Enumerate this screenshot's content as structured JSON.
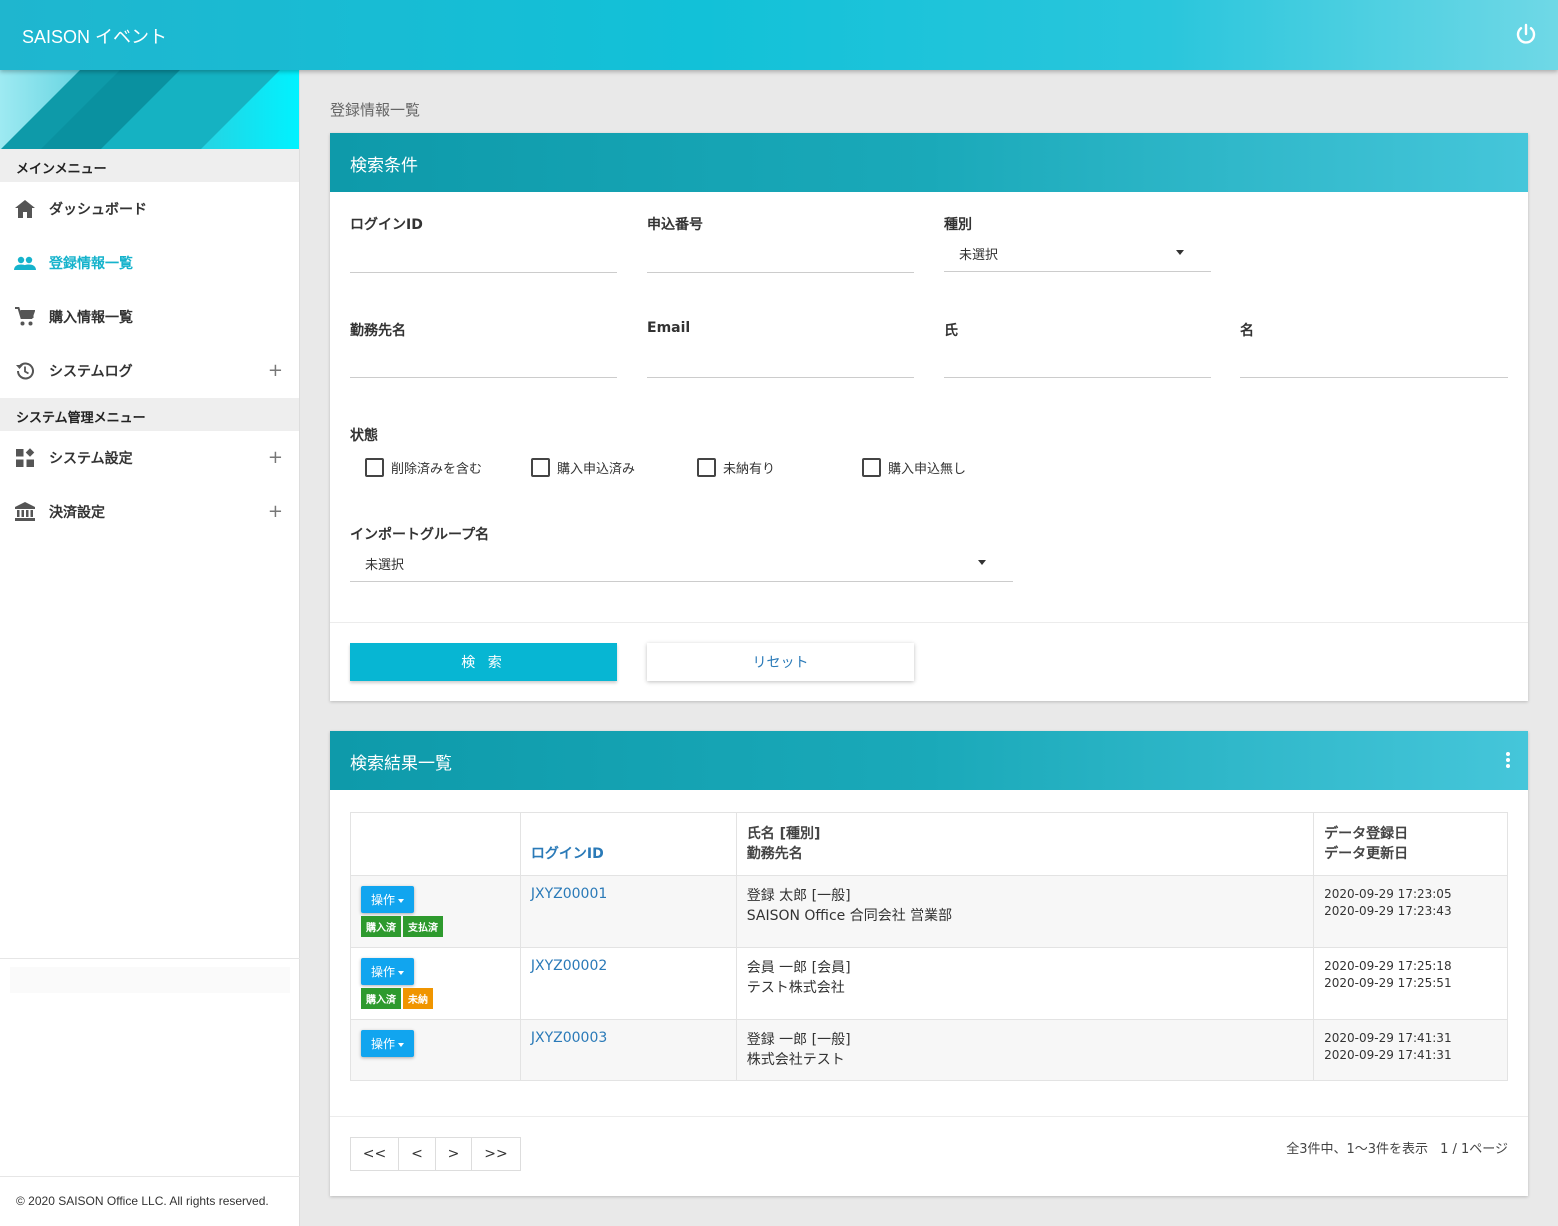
{
  "app": {
    "title": "SAISON イベント"
  },
  "sidebar": {
    "sections": [
      {
        "title": "メインメニュー"
      },
      {
        "title": "システム管理メニュー"
      }
    ],
    "items": [
      {
        "label": "ダッシュボード",
        "icon": "home-icon"
      },
      {
        "label": "登録情報一覧",
        "icon": "people-icon",
        "active": true
      },
      {
        "label": "購入情報一覧",
        "icon": "cart-icon"
      },
      {
        "label": "システムログ",
        "icon": "history-icon",
        "expandable": "+"
      },
      {
        "label": "システム設定",
        "icon": "widgets-icon",
        "expandable": "+"
      },
      {
        "label": "決済設定",
        "icon": "bank-icon",
        "expandable": "+"
      }
    ],
    "copyright": "© 2020 SAISON Office LLC. All rights reserved."
  },
  "page": {
    "title": "登録情報一覧"
  },
  "search": {
    "title": "検索条件",
    "fields": {
      "login_id": "ログインID",
      "application_no": "申込番号",
      "type": "種別",
      "type_value": "未選択",
      "company": "勤務先名",
      "email": "Email",
      "last_name": "氏",
      "first_name": "名",
      "status": "状態",
      "import_group": "インポートグループ名",
      "import_group_value": "未選択"
    },
    "checkboxes": [
      "削除済みを含む",
      "購入申込済み",
      "未納有り",
      "購入申込無し"
    ],
    "search_button": "検 索",
    "reset_button": "リセット"
  },
  "results": {
    "title": "検索結果一覧",
    "headers": {
      "login_id": "ログインID",
      "name_line1": "氏名 [種別]",
      "name_line2": "勤務先名",
      "date_line1": "データ登録日",
      "date_line2": "データ更新日"
    },
    "op_label": "操作",
    "rows": [
      {
        "login_id": "JXYZ00001",
        "name": "登録 太郎 [一般]",
        "company": "SAISON Office 合同会社 営業部",
        "created": "2020-09-29 17:23:05",
        "updated": "2020-09-29 17:23:43",
        "badge1": "購入済",
        "badge2": "支払済"
      },
      {
        "login_id": "JXYZ00002",
        "name": "会員 一郎 [会員]",
        "company": "テスト株式会社",
        "created": "2020-09-29 17:25:18",
        "updated": "2020-09-29 17:25:51",
        "badge1": "購入済",
        "badge2": "未納"
      },
      {
        "login_id": "JXYZ00003",
        "name": "登録 一郎 [一般]",
        "company": "株式会社テスト",
        "created": "2020-09-29 17:41:31",
        "updated": "2020-09-29 17:41:31"
      }
    ],
    "pager": {
      "first": "<<",
      "prev": "<",
      "next": ">",
      "last": ">>"
    },
    "summary": "全3件中、1〜3件を表示",
    "page_info": "1 / 1ページ"
  },
  "colors": {
    "accent": "#12c1d8",
    "header_teal": "#0e9aaa",
    "link": "#2a7ab8",
    "op_button": "#11a5ef",
    "badge_green": "#2e9a2e",
    "badge_orange": "#f09500"
  }
}
